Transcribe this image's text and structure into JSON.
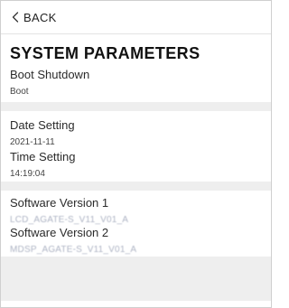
{
  "header": {
    "back_label": "BACK",
    "back_icon": "chevron-left-icon"
  },
  "page": {
    "title": "SYSTEM PARAMETERS"
  },
  "sections": {
    "boot": {
      "label": "Boot Shutdown",
      "value": "Boot"
    },
    "date": {
      "label": "Date Setting",
      "value": "2021-11-11"
    },
    "time": {
      "label": "Time Setting",
      "value": "14:19:04"
    },
    "software1": {
      "label": "Software Version 1",
      "value": "LCD_AGATE-S_V11_V01_A"
    },
    "software2": {
      "label": "Software Version 2",
      "value": "MDSP_AGATE-S_V11_V01_A"
    }
  },
  "colors": {
    "separator": "#eeeeee",
    "text": "#333333",
    "blurred_value": "#aeb4c4"
  }
}
